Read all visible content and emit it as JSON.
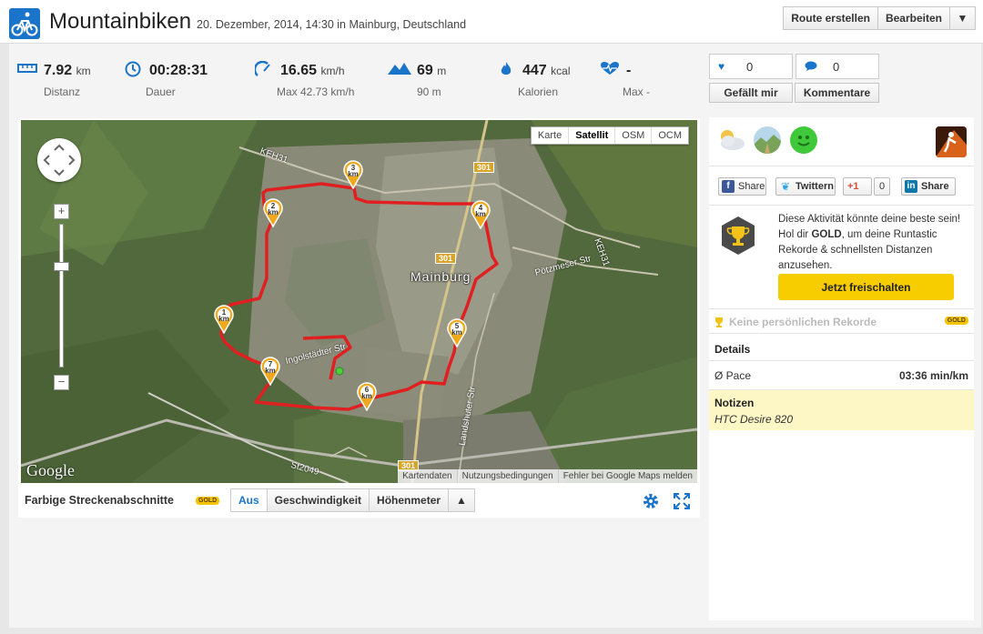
{
  "header": {
    "title": "Mountainbiken",
    "subtitle": "20. Dezember, 2014, 14:30 in Mainburg, Deutschland",
    "buttons": {
      "create_route": "Route erstellen",
      "edit": "Bearbeiten",
      "more": "▼"
    }
  },
  "stats": {
    "distance": {
      "value": "7.92",
      "unit": "km",
      "label": "Distanz",
      "icon": "ruler-icon"
    },
    "duration": {
      "value": "00:28:31",
      "unit": "",
      "label": "Dauer",
      "icon": "clock-icon"
    },
    "speed": {
      "value": "16.65",
      "unit": "km/h",
      "label": "Max 42.73 km/h",
      "icon": "speedometer-icon"
    },
    "elevation": {
      "value": "69",
      "unit": "m",
      "label": "90 m",
      "icon": "mountain-icon"
    },
    "calories": {
      "value": "447",
      "unit": "kcal",
      "label": "Kalorien",
      "icon": "flame-icon"
    },
    "heartrate": {
      "value": "-",
      "unit": "",
      "label": "Max -",
      "icon": "heart-rate-icon"
    }
  },
  "social": {
    "likes_count": "0",
    "comments_count": "0",
    "like_label": "Gefällt mir",
    "comments_label": "Kommentare"
  },
  "map": {
    "types": [
      "Karte",
      "Satellit",
      "OSM",
      "OCM"
    ],
    "active_type": "Satellit",
    "town": "Mainburg",
    "roads": [
      "KEH31",
      "KEH31",
      "Pötzmeser Str",
      "Ingolstädter Str",
      "Landshuter Str",
      "St2049"
    ],
    "shields": [
      "301",
      "301",
      "301"
    ],
    "markers": [
      {
        "num": "1",
        "unit": "km"
      },
      {
        "num": "2",
        "unit": "km"
      },
      {
        "num": "3",
        "unit": "km"
      },
      {
        "num": "4",
        "unit": "km"
      },
      {
        "num": "5",
        "unit": "km"
      },
      {
        "num": "6",
        "unit": "km"
      },
      {
        "num": "7",
        "unit": "km"
      }
    ],
    "logo": "Google",
    "footer": [
      "Kartendaten",
      "Nutzungsbedingungen",
      "Fehler bei Google Maps melden"
    ]
  },
  "map_toolbar": {
    "label": "Farbige Streckenabschnitte",
    "gold": "GOLD",
    "segments": [
      "Aus",
      "Geschwindigkeit",
      "Höhenmeter",
      "▲"
    ],
    "active_segment": "Aus"
  },
  "sidebar": {
    "share": {
      "facebook": "Share",
      "twitter": "Twittern",
      "gplus_label": "+1",
      "gplus_count": "0",
      "linkedin": "Share"
    },
    "promo": {
      "text_before": "Diese Aktivität könnte deine beste sein! Hol dir ",
      "text_bold": "GOLD",
      "text_after": ", um deine Runtastic Rekorde & schnellsten Distanzen anzusehen.",
      "button": "Jetzt freischalten"
    },
    "records_label": "Keine persönlichen Rekorde",
    "records_gold": "GOLD",
    "details_heading": "Details",
    "pace_label": "Ø Pace",
    "pace_value": "03:36 min/km",
    "notes_heading": "Notizen",
    "notes_value": "HTC Desire 820"
  },
  "colors": {
    "accent": "#1a74c9",
    "route": "#e02020",
    "gold": "#f7cd00",
    "notes_bg": "#fdf7c6"
  }
}
